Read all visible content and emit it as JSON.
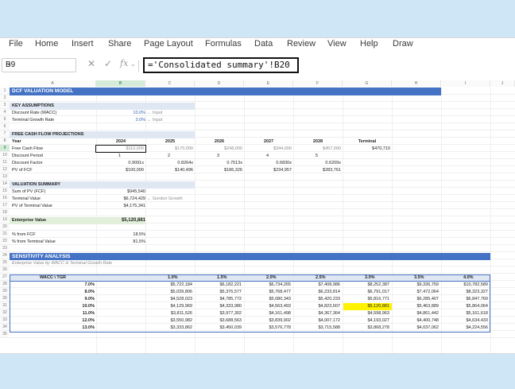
{
  "menu": [
    "File",
    "Home",
    "Insert",
    "Share",
    "Page Layout",
    "Formulas",
    "Data",
    "Review",
    "View",
    "Help",
    "Draw"
  ],
  "formula_bar": {
    "name_box": "B9",
    "cancel_icon": "✕",
    "enter_icon": "✓",
    "fx_label": "fx",
    "formula": "='Consolidated summary'!B20"
  },
  "columns": [
    "A",
    "B",
    "C",
    "D",
    "E",
    "F",
    "G",
    "H",
    "I",
    "J"
  ],
  "selected_column": "B",
  "selected_row": "9",
  "rows": [
    "1",
    "2",
    "3",
    "4",
    "5",
    "6",
    "7",
    "8",
    "9",
    "10",
    "11",
    "12",
    "13",
    "14",
    "15",
    "16",
    "17",
    "18",
    "19",
    "20",
    "21",
    "22",
    "23",
    "24",
    "25",
    "26",
    "27",
    "28",
    "29",
    "30",
    "31",
    "32",
    "33",
    "34",
    "35"
  ],
  "model": {
    "title": "DCF VALUATION MODEL",
    "key_assumptions": "KEY ASSUMPTIONS",
    "discount_rate_label": "Discount Rate (WACC)",
    "discount_rate_value": "10.0%",
    "discount_rate_note": "← Input",
    "tgr_label": "Terminal Growth Rate",
    "tgr_value": "3.0%",
    "tgr_note": "← Input",
    "fcf_projections": "FREE CASH FLOW PROJECTIONS",
    "year_label": "Year",
    "years": [
      "2024",
      "2025",
      "2026",
      "2027",
      "2028",
      "Terminal"
    ],
    "fcf_label": "Free Cash Flow",
    "fcf": [
      "$110,000",
      "$170,000",
      "$248,000",
      "$344,000",
      "$457,000",
      "$470,710"
    ],
    "period_label": "Discount Period",
    "periods": [
      "1",
      "2",
      "3",
      "4",
      "5"
    ],
    "factor_label": "Discount Factor",
    "factors": [
      "0.9091x",
      "0.8264x",
      "0.7513x",
      "0.6830x",
      "0.6209x"
    ],
    "pv_label": "PV of FCF",
    "pv": [
      "$100,000",
      "$140,496",
      "$186,326",
      "$234,957",
      "$283,761"
    ],
    "valuation_summary": "VALUATION SUMMARY",
    "sum_pv_label": "Sum of PV (FCF)",
    "sum_pv_value": "$945,540",
    "terminal_value_label": "Terminal Value",
    "terminal_value_value": "$6,724,429",
    "terminal_value_note": "← Gordon Growth",
    "pv_terminal_label": "PV of Terminal Value",
    "pv_terminal_value": "$4,175,341",
    "ev_label": "Enterprise Value",
    "ev_value": "$5,120,881",
    "pct_fcf_label": "% from FCF",
    "pct_fcf_value": "18.5%",
    "pct_tv_label": "% from Terminal Value",
    "pct_tv_value": "81.5%",
    "sensitivity_title": "SENSITIVITY ANALYSIS",
    "sensitivity_subtitle": "Enterprise Value by WACC & Terminal Growth Rate"
  },
  "sensitivity": {
    "corner": "WACC \\ TGR",
    "tgr": [
      "1.0%",
      "1.5%",
      "2.0%",
      "2.5%",
      "3.0%",
      "3.5%",
      "4.0%"
    ],
    "rows": [
      {
        "wacc": "7.0%",
        "values": [
          "$5,722,184",
          "$6,182,221",
          "$6,734,265",
          "$7,408,986",
          "$8,252,387",
          "$9,336,759",
          "$10,782,589"
        ]
      },
      {
        "wacc": "8.0%",
        "values": [
          "$5,039,806",
          "$5,376,577",
          "$5,768,477",
          "$6,233,814",
          "$6,791,017",
          "$7,472,064",
          "$8,323,327"
        ]
      },
      {
        "wacc": "9.0%",
        "values": [
          "$4,528,023",
          "$4,785,772",
          "$5,080,343",
          "$5,420,233",
          "$5,816,771",
          "$6,285,407",
          "$6,847,769"
        ]
      },
      {
        "wacc": "10.0%",
        "values": [
          "$4,129,969",
          "$4,333,980",
          "$4,563,493",
          "$4,823,607",
          "$5,120,881",
          "$5,463,889",
          "$5,864,064"
        ]
      },
      {
        "wacc": "11.0%",
        "values": [
          "$3,811,526",
          "$3,977,302",
          "$4,161,498",
          "$4,367,364",
          "$4,598,963",
          "$4,861,442",
          "$5,161,618"
        ]
      },
      {
        "wacc": "12.0%",
        "values": [
          "$3,550,982",
          "$3,688,563",
          "$3,839,902",
          "$4,007,172",
          "$4,193,027",
          "$4,400,748",
          "$4,634,433"
        ]
      },
      {
        "wacc": "13.0%",
        "values": [
          "$3,333,862",
          "$3,450,039",
          "$3,576,778",
          "$3,715,588",
          "$3,868,278",
          "$4,037,062",
          "$4,224,556"
        ]
      }
    ],
    "highlight_color": "#fff200"
  },
  "colors": {
    "title_bar": "#4472c4",
    "section_band": "#dfe7f2",
    "selected_header": "#d4ebd9",
    "input_blue": "#3563b0"
  }
}
